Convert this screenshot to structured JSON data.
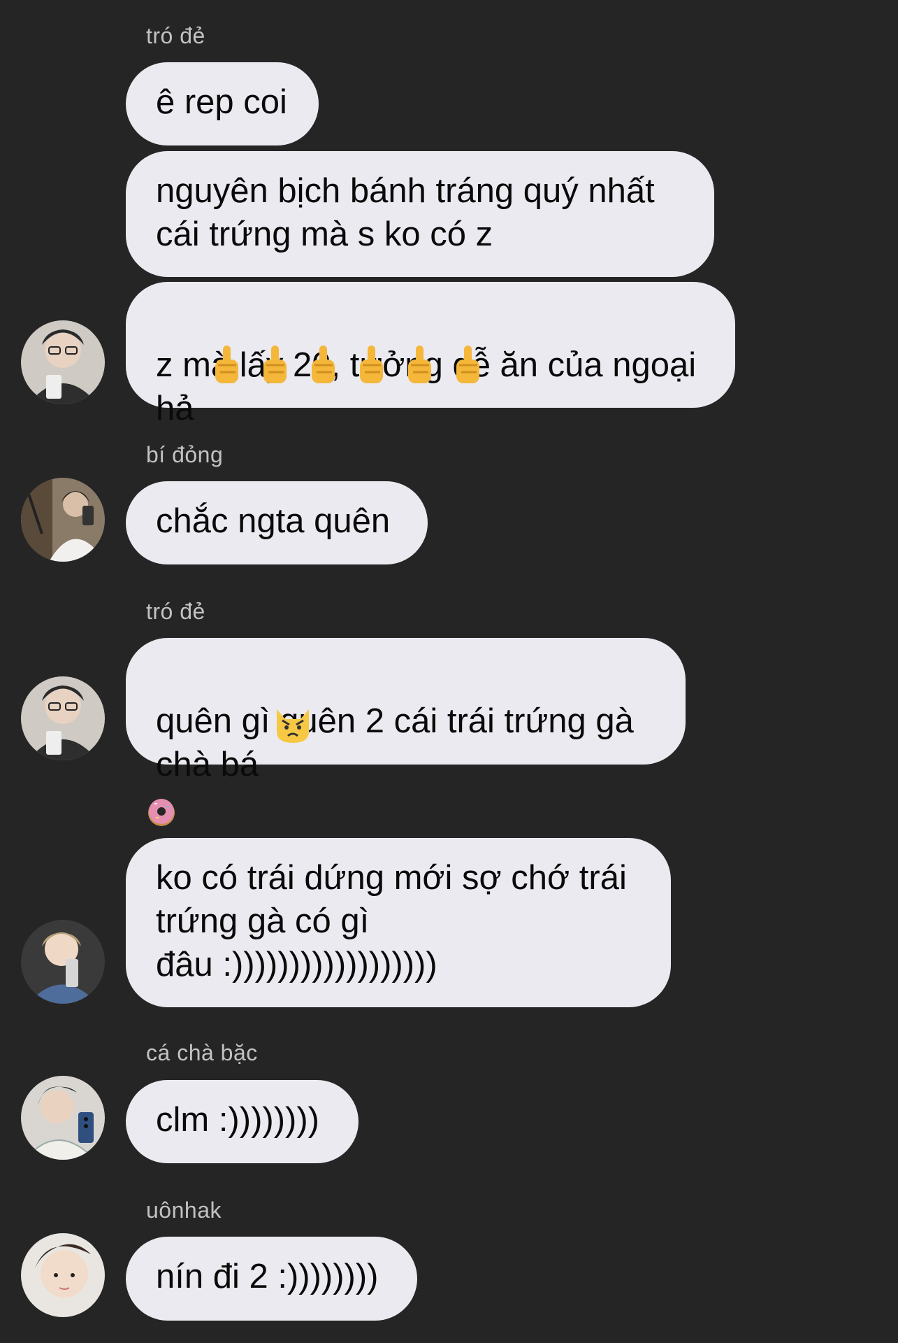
{
  "messages": [
    {
      "sender": "tró đẻ",
      "bubbles": [
        "ê rep coi",
        "nguyên bịch bánh tráng quý nhất\ncái trứng mà s ko có z",
        "z mà lấy 20, tưởng dễ ăn của ngoại\nhả"
      ],
      "emoji_after_last": "middle-finger x6"
    },
    {
      "sender": "bí đỏng",
      "bubbles": [
        "chắc ngta quên"
      ]
    },
    {
      "sender": "tró đẻ",
      "bubbles": [
        "quên gì quên 2 cái trái trứng gà\nchà bá"
      ],
      "emoji_after_last": "pouting-cat"
    },
    {
      "sender_emoji": "doughnut",
      "bubbles": [
        "ko có trái dứng mới sợ chớ trái\ntrứng gà có gì\nđâu :))))))))))))))))))"
      ]
    },
    {
      "sender": "cá chà bặc",
      "bubbles": [
        "clm :))))))))"
      ]
    },
    {
      "sender": "uônhak",
      "bubbles": [
        "nín đi 2 :))))))))"
      ]
    }
  ],
  "colors": {
    "background": "#252525",
    "bubble": "#eaeaf0",
    "sender_text": "#c2c2c2",
    "message_text": "#0a0a0a"
  }
}
